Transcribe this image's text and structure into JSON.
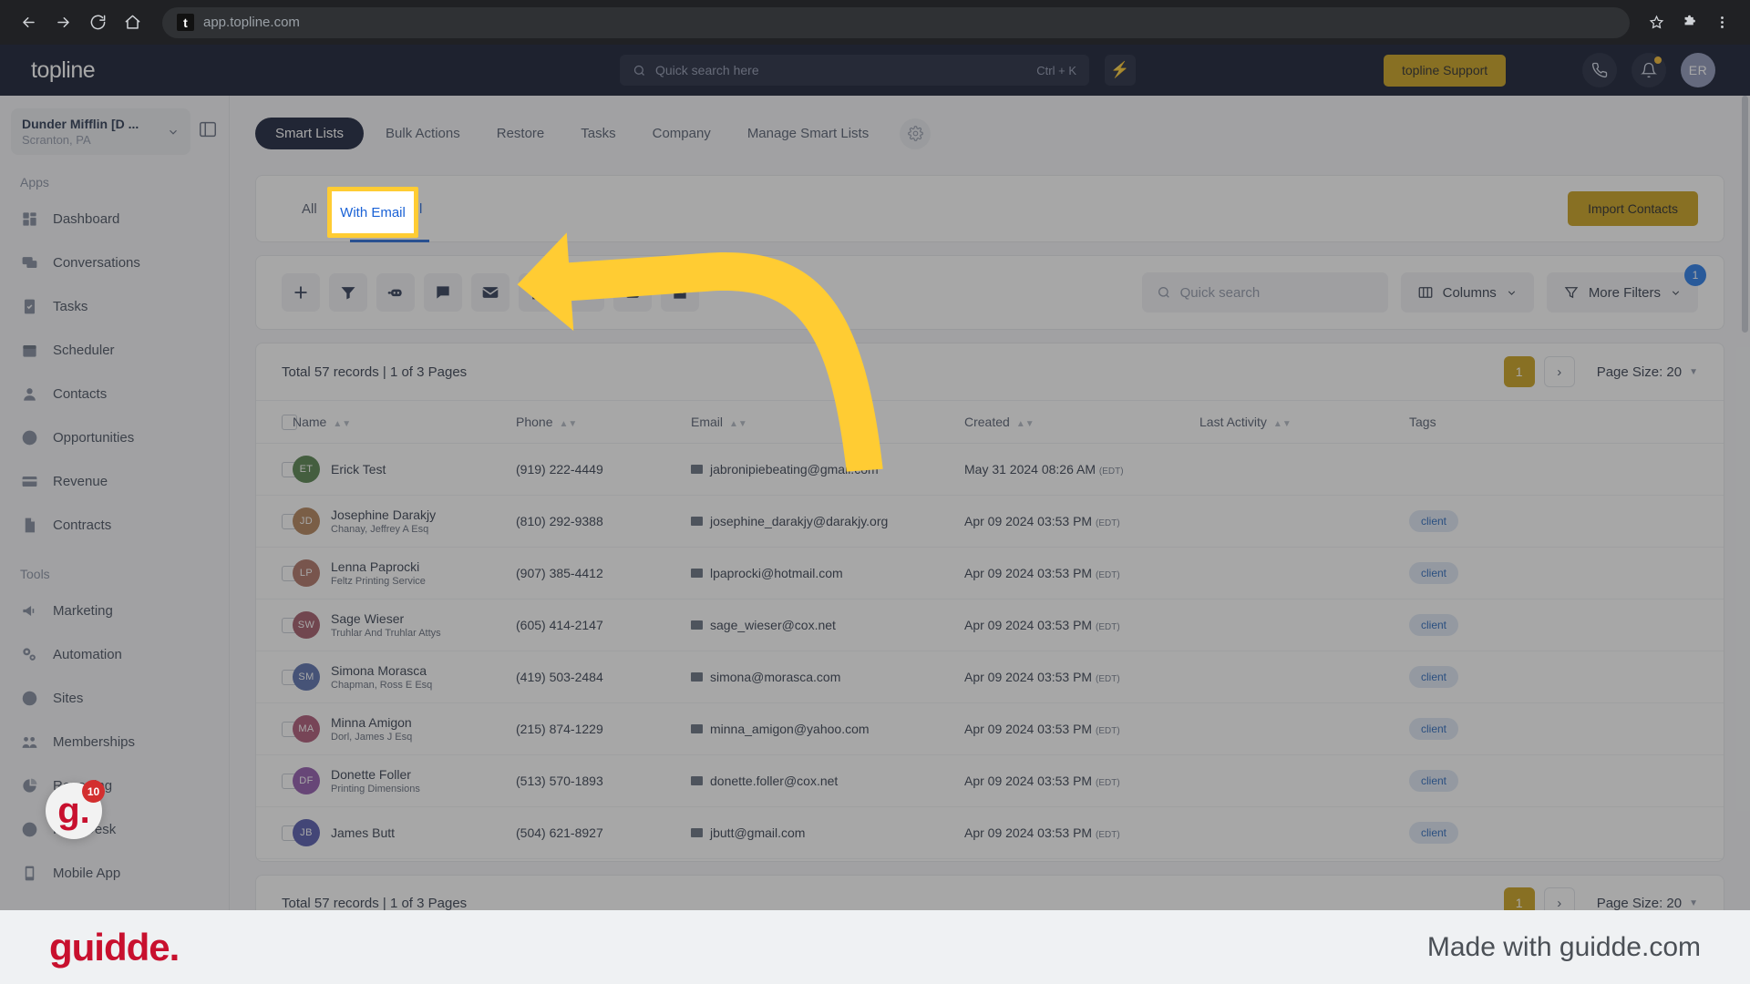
{
  "browser": {
    "url": "app.topline.com",
    "favicon_letter": "t",
    "back_icon": "back-arrow-icon",
    "forward_icon": "forward-arrow-icon",
    "reload_icon": "reload-icon",
    "home_icon": "home-icon",
    "star_icon": "bookmark-star-icon",
    "extensions_icon": "extensions-puzzle-icon",
    "menu_icon": "three-dot-menu-icon"
  },
  "topnav": {
    "logo": "topline",
    "search_placeholder": "Quick search here",
    "search_shortcut": "Ctrl + K",
    "bolt_label": "⚡",
    "support_button": "topline Support",
    "avatar_initials": "ER"
  },
  "sidebar": {
    "org_name": "Dunder Mifflin [D ...",
    "org_location": "Scranton, PA",
    "sections": [
      {
        "label": "Apps",
        "items": [
          {
            "label": "Dashboard",
            "icon": "dashboard-icon"
          },
          {
            "label": "Conversations",
            "icon": "conversations-icon"
          },
          {
            "label": "Tasks",
            "icon": "tasks-icon"
          },
          {
            "label": "Scheduler",
            "icon": "calendar-icon"
          },
          {
            "label": "Contacts",
            "icon": "person-icon"
          },
          {
            "label": "Opportunities",
            "icon": "target-icon"
          },
          {
            "label": "Revenue",
            "icon": "card-icon"
          },
          {
            "label": "Contracts",
            "icon": "document-icon"
          }
        ]
      },
      {
        "label": "Tools",
        "items": [
          {
            "label": "Marketing",
            "icon": "megaphone-icon"
          },
          {
            "label": "Automation",
            "icon": "gears-icon"
          },
          {
            "label": "Sites",
            "icon": "globe-icon"
          },
          {
            "label": "Memberships",
            "icon": "memberships-icon"
          },
          {
            "label": "Reporting",
            "icon": "pie-chart-icon"
          },
          {
            "label": "Help Desk",
            "icon": "help-circle-icon"
          },
          {
            "label": "Mobile App",
            "icon": "mobile-icon"
          }
        ]
      }
    ]
  },
  "main": {
    "tabs": [
      {
        "label": "Smart Lists",
        "active": true
      },
      {
        "label": "Bulk Actions",
        "active": false
      },
      {
        "label": "Restore",
        "active": false
      },
      {
        "label": "Tasks",
        "active": false
      },
      {
        "label": "Company",
        "active": false
      },
      {
        "label": "Manage Smart Lists",
        "active": false
      }
    ],
    "tab_gear_icon": "gear-icon",
    "subtabs": [
      {
        "label": "All",
        "active": false
      },
      {
        "label": "With Email",
        "active": true
      }
    ],
    "import_button": "Import Contacts",
    "toolbar_icons": [
      "add-contact-icon",
      "filter-icon",
      "bot-icon",
      "sms-message-icon",
      "email-icon",
      "add-tag-icon",
      "remove-tag-icon",
      "export-icon",
      "company-icon"
    ],
    "quick_search_placeholder": "Quick search",
    "columns_button": "Columns",
    "more_filters_button": "More Filters",
    "filters_badge": "1"
  },
  "table": {
    "records_label": "Total 57 records | 1 of 3 Pages",
    "page_number": "1",
    "next_page_icon": "chevron-right-icon",
    "page_size_label": "Page Size: 20",
    "headers": [
      "Name",
      "Phone",
      "Email",
      "Created",
      "Last Activity",
      "Tags"
    ],
    "rows": [
      {
        "initials": "ET",
        "avatar_color": "#4c7a43",
        "name": "Erick Test",
        "company": "",
        "phone": "(919) 222-4449",
        "email": "jabronipiebeating@gmail.com",
        "created": "May 31 2024 08:26 AM",
        "tz": "(EDT)",
        "last_activity": "",
        "tag": ""
      },
      {
        "initials": "JD",
        "avatar_color": "#ad7b4f",
        "name": "Josephine Darakjy",
        "company": "Chanay, Jeffrey A Esq",
        "phone": "(810) 292-9388",
        "email": "josephine_darakjy@darakjy.org",
        "created": "Apr 09 2024 03:53 PM",
        "tz": "(EDT)",
        "last_activity": "",
        "tag": "client"
      },
      {
        "initials": "LP",
        "avatar_color": "#a96a5c",
        "name": "Lenna Paprocki",
        "company": "Feltz Printing Service",
        "phone": "(907) 385-4412",
        "email": "lpaprocki@hotmail.com",
        "created": "Apr 09 2024 03:53 PM",
        "tz": "(EDT)",
        "last_activity": "",
        "tag": "client"
      },
      {
        "initials": "SW",
        "avatar_color": "#9d4f60",
        "name": "Sage Wieser",
        "company": "Truhlar And Truhlar Attys",
        "phone": "(605) 414-2147",
        "email": "sage_wieser@cox.net",
        "created": "Apr 09 2024 03:53 PM",
        "tz": "(EDT)",
        "last_activity": "",
        "tag": "client"
      },
      {
        "initials": "SM",
        "avatar_color": "#4f67a8",
        "name": "Simona Morasca",
        "company": "Chapman, Ross E Esq",
        "phone": "(419) 503-2484",
        "email": "simona@morasca.com",
        "created": "Apr 09 2024 03:53 PM",
        "tz": "(EDT)",
        "last_activity": "",
        "tag": "client"
      },
      {
        "initials": "MA",
        "avatar_color": "#a84d6e",
        "name": "Minna Amigon",
        "company": "Dorl, James J Esq",
        "phone": "(215) 874-1229",
        "email": "minna_amigon@yahoo.com",
        "created": "Apr 09 2024 03:53 PM",
        "tz": "(EDT)",
        "last_activity": "",
        "tag": "client"
      },
      {
        "initials": "DF",
        "avatar_color": "#8b4fa8",
        "name": "Donette Foller",
        "company": "Printing Dimensions",
        "phone": "(513) 570-1893",
        "email": "donette.foller@cox.net",
        "created": "Apr 09 2024 03:53 PM",
        "tz": "(EDT)",
        "last_activity": "",
        "tag": "client"
      },
      {
        "initials": "JB",
        "avatar_color": "#4a4fa8",
        "name": "James Butt",
        "company": "",
        "phone": "(504) 621-8927",
        "email": "jbutt@gmail.com",
        "created": "Apr 09 2024 03:53 PM",
        "tz": "(EDT)",
        "last_activity": "",
        "tag": "client"
      }
    ],
    "footer_records_label": "Total 57 records | 1 of 3 Pages",
    "footer_page_number": "1",
    "footer_page_size_label": "Page Size: 20"
  },
  "annotation": {
    "highlight_label": "With Email",
    "arrow_color": "#FFCC33",
    "highlight_border_color": "#FFCC33"
  },
  "guidde": {
    "badge_count": "10",
    "logo_mark": "g.",
    "footer_logo": "guidde.",
    "footer_text": "Made with guidde.com"
  }
}
